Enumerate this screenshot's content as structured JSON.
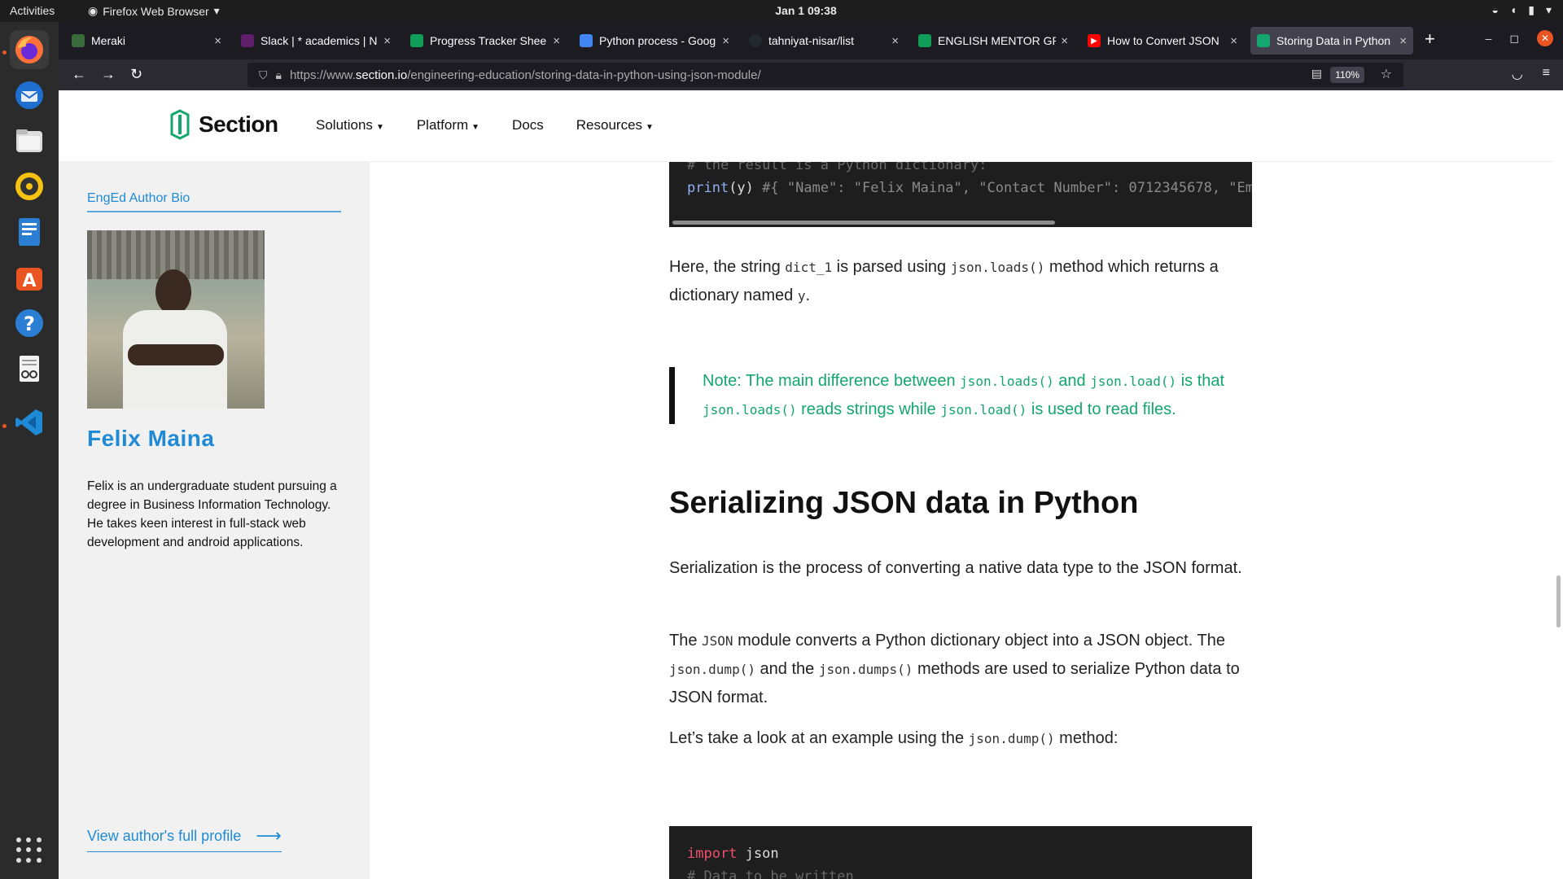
{
  "os": {
    "activities": "Activities",
    "app_name": "Firefox Web Browser",
    "clock": "Jan 1  09:38"
  },
  "browser": {
    "tabs": [
      {
        "title": "Meraki",
        "fav_color": "#3a6b3a"
      },
      {
        "title": "Slack | * academics | N",
        "fav_color": "#611f69"
      },
      {
        "title": "Progress Tracker Shee",
        "fav_color": "#0f9d58"
      },
      {
        "title": "Python process - Goog",
        "fav_color": "#4285f4"
      },
      {
        "title": "tahniyat-nisar/list",
        "fav_color": "#24292f"
      },
      {
        "title": "ENGLISH MENTOR GRO",
        "fav_color": "#0f9d58"
      },
      {
        "title": "How to Convert JSON",
        "fav_color": "#ff0000"
      },
      {
        "title": "Storing Data in Python",
        "fav_color": "#13a66e"
      }
    ],
    "url_prefix": "https://www.",
    "url_host": "section.io",
    "url_path": "/engineering-education/storing-data-in-python-using-json-module/",
    "zoom": "110%"
  },
  "site": {
    "logo_text": "Section",
    "nav": [
      "Solutions",
      "Platform",
      "Docs",
      "Resources"
    ]
  },
  "sidebar": {
    "heading": "EngEd Author Bio",
    "author_name": "Felix Maina",
    "bio": "Felix is an undergraduate student pursuing a degree in Business Information Technology. He takes keen interest in full-stack web development and android applications.",
    "profile_link": "View author's full profile"
  },
  "article": {
    "code1_comment": "# the result is a Python dictionary:",
    "code1_fn": "print",
    "code1_args": "(y)",
    "code1_trailing": "   #{ \"Name\": \"Felix Maina\", \"Contact Number\": 0712345678, \"Email\": \"felix@",
    "p1_a": "Here, the string ",
    "p1_code1": "dict_1",
    "p1_b": " is parsed using ",
    "p1_code2": "json.loads()",
    "p1_c": " method which returns a dictionary named ",
    "p1_code3": "y",
    "p1_d": ".",
    "note_a": "Note: The main difference between ",
    "note_code1": "json.loads()",
    "note_b": " and ",
    "note_code2": "json.load()",
    "note_c": " is that ",
    "note_code3": "json.loads()",
    "note_d": " reads strings while ",
    "note_code4": "json.load()",
    "note_e": " is used to read files.",
    "heading": "Serializing JSON data in Python",
    "p2": "Serialization is the process of converting a native data type to the JSON format.",
    "p3_a": "The ",
    "p3_code1": "JSON",
    "p3_b": " module converts a Python dictionary object into a JSON object. The ",
    "p3_code2": "json.dump()",
    "p3_c": " and the ",
    "p3_code3": "json.dumps()",
    "p3_d": " methods are used to serialize Python data to JSON format.",
    "p4_a": "Let’s take a look at an example using the ",
    "p4_code": "json.dump()",
    "p4_b": " method:",
    "code2_kw": "import",
    "code2_rest": " json",
    "code2_comment": "# Data to be written"
  }
}
